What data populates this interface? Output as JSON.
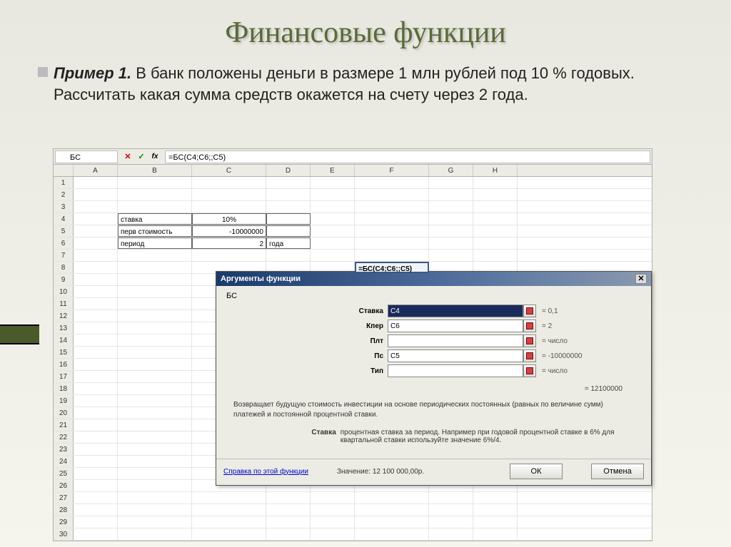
{
  "slide": {
    "title": "Финансовые функции",
    "example_label": "Пример 1.",
    "body": "В банк положены деньги в размере 1 млн рублей под 10 % годовых. Рассчитать какая сумма средств окажется на счету через 2 года."
  },
  "formula_bar": {
    "name_box": "БС",
    "formula": "=БС(C4;C6;;C5)"
  },
  "columns": [
    "A",
    "B",
    "C",
    "D",
    "E",
    "F",
    "G",
    "H"
  ],
  "rows": [
    "1",
    "2",
    "3",
    "4",
    "5",
    "6",
    "7",
    "8",
    "9",
    "10",
    "11",
    "12",
    "13",
    "14",
    "15",
    "16",
    "17",
    "18",
    "19",
    "20",
    "21",
    "22",
    "23",
    "24",
    "25",
    "26",
    "27",
    "28",
    "29",
    "30"
  ],
  "cells": {
    "b4": "ставка",
    "c4": "10%",
    "b5": "перв стоимость",
    "c5": "-10000000",
    "b6": "период",
    "c6": "2",
    "d6": "года",
    "f8": "=БС(C4;C6;;C5)"
  },
  "dialog": {
    "title": "Аргументы функции",
    "func": "БС",
    "args": [
      {
        "label": "Ставка",
        "value": "C4",
        "result": "= 0,1",
        "selected": true
      },
      {
        "label": "Кпер",
        "value": "C6",
        "result": "= 2",
        "selected": false
      },
      {
        "label": "Плт",
        "value": "",
        "result": "= число",
        "selected": false
      },
      {
        "label": "Пс",
        "value": "C5",
        "result": "= -10000000",
        "selected": false
      },
      {
        "label": "Тип",
        "value": "",
        "result": "= число",
        "selected": false
      }
    ],
    "result": "= 12100000",
    "description": "Возвращает будущую стоимость инвестиции на основе периодических постоянных (равных по величине сумм) платежей и постоянной процентной ставки.",
    "arg_desc_label": "Ставка",
    "arg_desc_text": "процентная ставка за период. Например при годовой процентной ставке в 6% для квартальной ставки используйте значение 6%/4.",
    "help_link": "Справка по этой функции",
    "value_label": "Значение: 12 100 000,00р.",
    "ok": "ОК",
    "cancel": "Отмена"
  }
}
